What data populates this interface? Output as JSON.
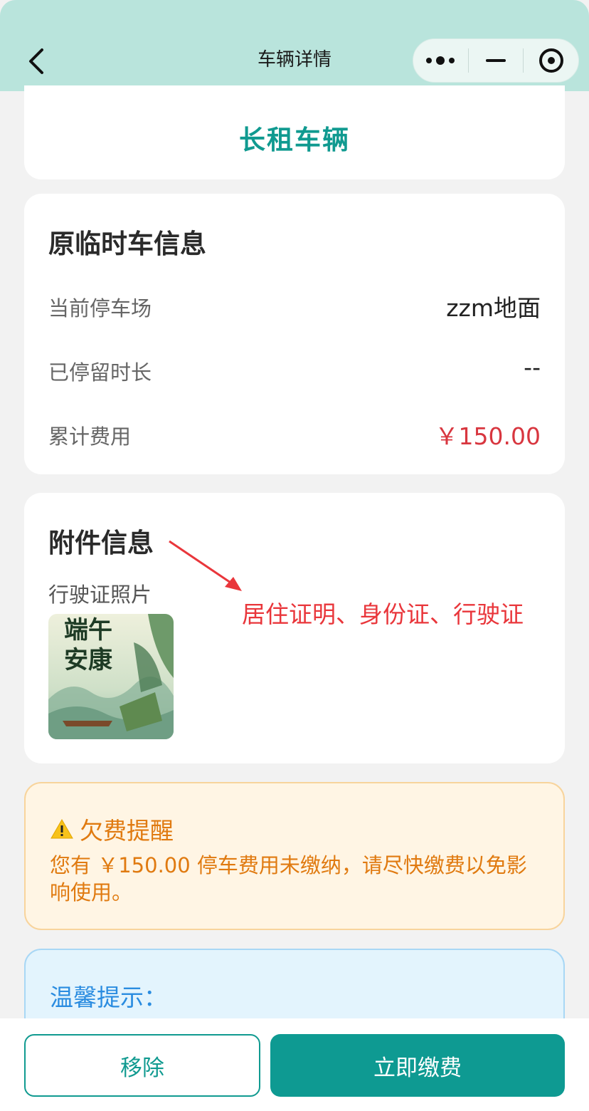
{
  "header": {
    "title": "车辆详情"
  },
  "lease": {
    "title": "长租车辆"
  },
  "info": {
    "section_title": "原临时车信息",
    "rows": [
      {
        "label": "当前停车场",
        "value": "zzm地面"
      },
      {
        "label": "已停留时长",
        "value": "--"
      },
      {
        "label": "累计费用",
        "value": "￥150.00"
      }
    ]
  },
  "attachment": {
    "section_title": "附件信息",
    "photo_label": "行驶证照片",
    "annotation": "居住证明、身份证、行驶证",
    "thumbnail_text": [
      "端午",
      "安康"
    ]
  },
  "warning": {
    "title": "欠费提醒",
    "message": "您有 ￥150.00 停车费用未缴纳，请尽快缴费以免影响使用。"
  },
  "tip": {
    "title": "温馨提示："
  },
  "actions": {
    "remove_label": "移除",
    "pay_label": "立即缴费"
  },
  "colors": {
    "header_bg": "#b9e4dc",
    "primary": "#109a90",
    "danger": "#d8363f",
    "warning": "#e07a10",
    "tip": "#2a8ce0"
  }
}
